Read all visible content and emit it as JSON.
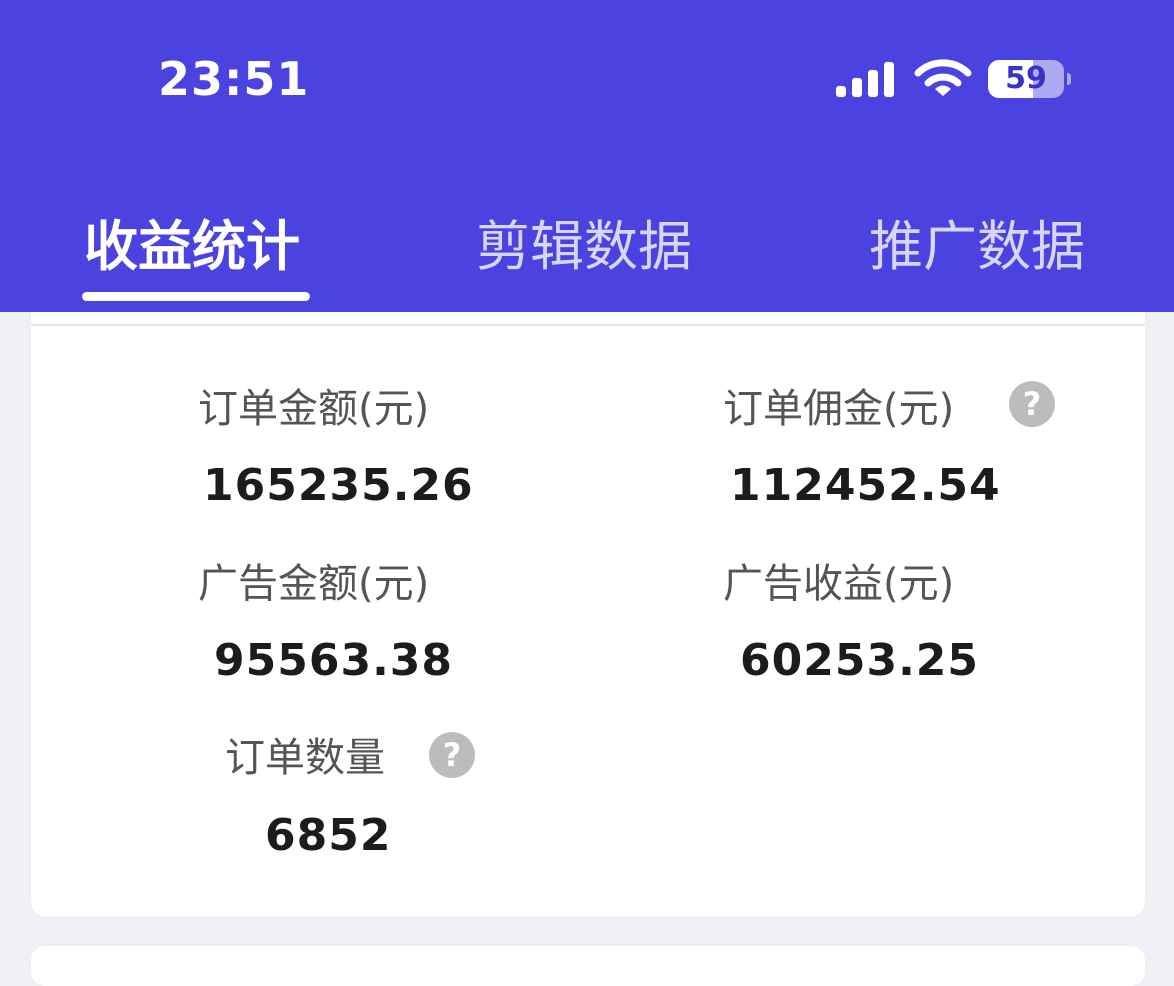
{
  "status_bar": {
    "time": "23:51",
    "battery_level": "59",
    "signal_icon": "signal-bars-icon",
    "wifi_icon": "wifi-icon"
  },
  "tabs": [
    {
      "label": "收益统计",
      "active": true
    },
    {
      "label": "剪辑数据",
      "active": false
    },
    {
      "label": "推广数据",
      "active": false
    }
  ],
  "stats": {
    "order_amount": {
      "label": "订单金额(元)",
      "value": "165235.26"
    },
    "order_commission": {
      "label": "订单佣金(元)",
      "value": "112452.54",
      "help_icon": "?"
    },
    "ad_amount": {
      "label": "广告金额(元)",
      "value": "95563.38"
    },
    "ad_revenue": {
      "label": "广告收益(元)",
      "value": "60253.25"
    },
    "order_count": {
      "label": "订单数量",
      "value": "6852",
      "help_icon": "?"
    }
  },
  "colors": {
    "header_bg": "#4b43e0",
    "page_bg": "#eef0f4",
    "card_bg": "#ffffff",
    "help_icon_bg": "#bcbcbc"
  }
}
